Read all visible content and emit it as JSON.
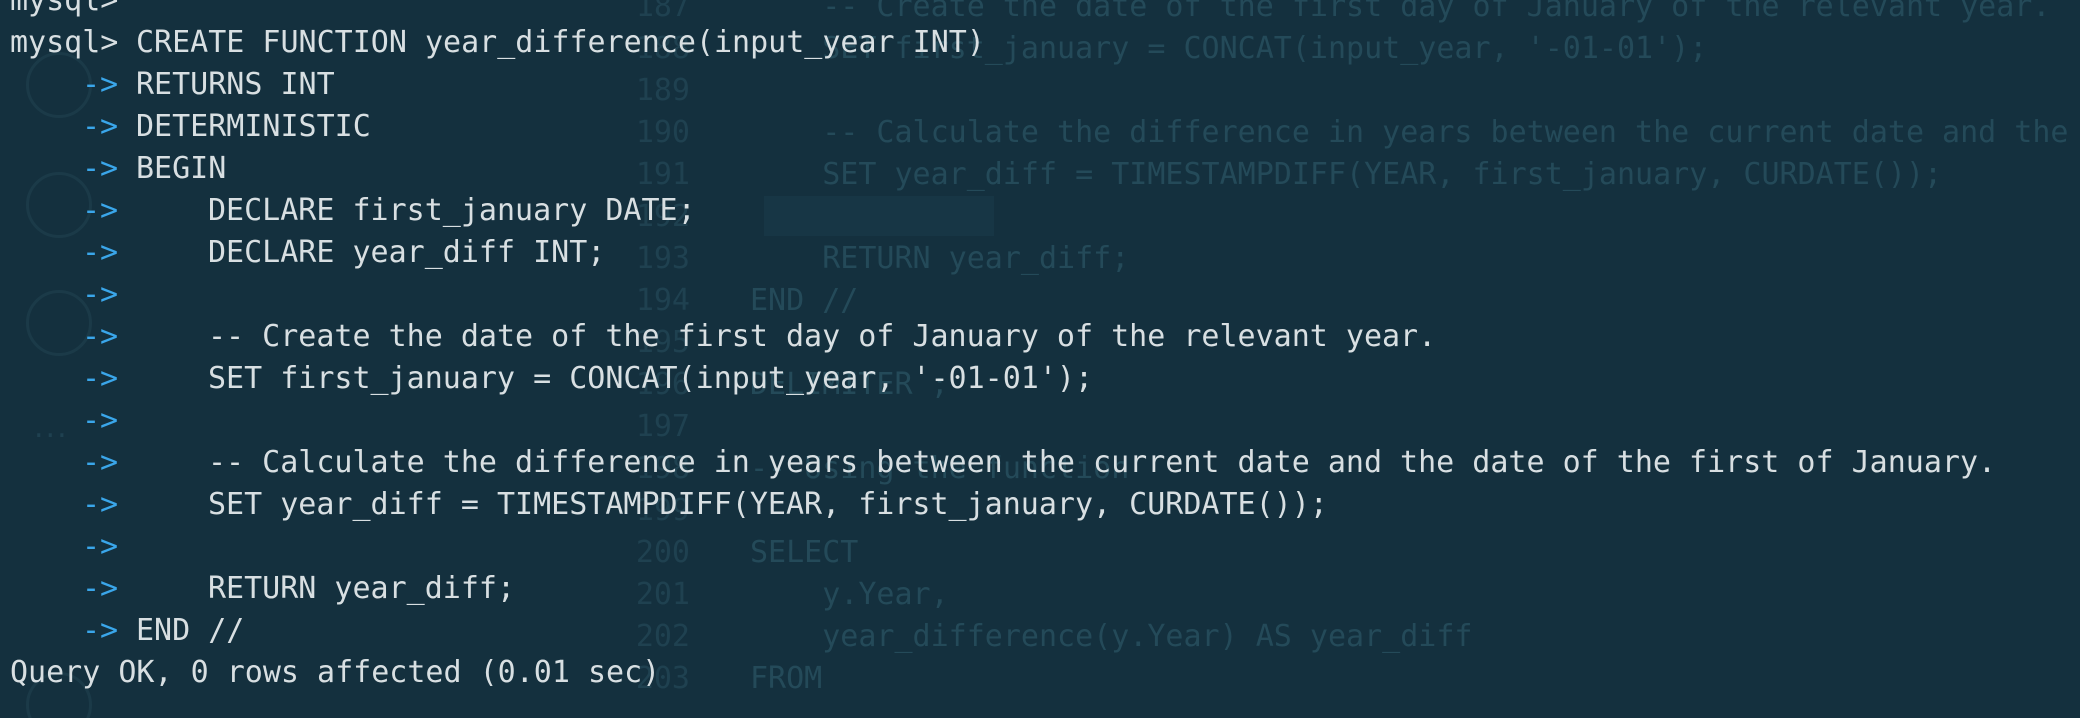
{
  "background_editor": {
    "lines": [
      {
        "num": "187",
        "code": "    -- Create the date of the first day of January of the relevant year."
      },
      {
        "num": "188",
        "code": "    SET first_january = CONCAT(input_year, '-01-01');"
      },
      {
        "num": "189",
        "code": ""
      },
      {
        "num": "190",
        "code": "    -- Calculate the difference in years between the current date and the dat"
      },
      {
        "num": "191",
        "code": "    SET year_diff = TIMESTAMPDIFF(YEAR, first_january, CURDATE());"
      },
      {
        "num": "192",
        "code": ""
      },
      {
        "num": "193",
        "code": "    RETURN year_diff;"
      },
      {
        "num": "194",
        "code": "END //"
      },
      {
        "num": "195",
        "code": ""
      },
      {
        "num": "196",
        "code": "DELIMITER ;"
      },
      {
        "num": "197",
        "code": ""
      },
      {
        "num": "198",
        "code": "-- Using the function"
      },
      {
        "num": "199",
        "code": ""
      },
      {
        "num": "200",
        "code": "SELECT"
      },
      {
        "num": "201",
        "code": "    y.Year,"
      },
      {
        "num": "202",
        "code": "    year_difference(y.Year) AS year_diff"
      },
      {
        "num": "203",
        "code": "FROM"
      }
    ]
  },
  "terminal": {
    "prompt": "mysql>",
    "continuation": "->",
    "lines": [
      {
        "kind": "prompt",
        "indent": 0,
        "text": ""
      },
      {
        "kind": "prompt",
        "indent": 0,
        "text": "CREATE FUNCTION year_difference(input_year INT)"
      },
      {
        "kind": "cont",
        "indent": 0,
        "text": "RETURNS INT"
      },
      {
        "kind": "cont",
        "indent": 0,
        "text": "DETERMINISTIC"
      },
      {
        "kind": "cont",
        "indent": 0,
        "text": "BEGIN"
      },
      {
        "kind": "cont",
        "indent": 1,
        "text": "DECLARE first_january DATE;"
      },
      {
        "kind": "cont",
        "indent": 1,
        "text": "DECLARE year_diff INT;"
      },
      {
        "kind": "cont",
        "indent": 1,
        "text": ""
      },
      {
        "kind": "cont",
        "indent": 1,
        "text": "-- Create the date of the first day of January of the relevant year."
      },
      {
        "kind": "cont",
        "indent": 1,
        "text": "SET first_january = CONCAT(input_year, '-01-01');"
      },
      {
        "kind": "cont",
        "indent": 1,
        "text": ""
      },
      {
        "kind": "cont",
        "indent": 1,
        "text": "-- Calculate the difference in years between the current date and the date of the first of January."
      },
      {
        "kind": "cont",
        "indent": 1,
        "text": "SET year_diff = TIMESTAMPDIFF(YEAR, first_january, CURDATE());"
      },
      {
        "kind": "cont",
        "indent": 1,
        "text": ""
      },
      {
        "kind": "cont",
        "indent": 1,
        "text": "RETURN year_diff;"
      },
      {
        "kind": "cont",
        "indent": 0,
        "text": "END //"
      },
      {
        "kind": "status",
        "indent": 0,
        "text": "Query OK, 0 rows affected (0.01 sec)"
      }
    ]
  },
  "colors": {
    "background": "#14303e",
    "text": "#d8dfe2",
    "continuation_arrow": "#3aa6ea"
  }
}
